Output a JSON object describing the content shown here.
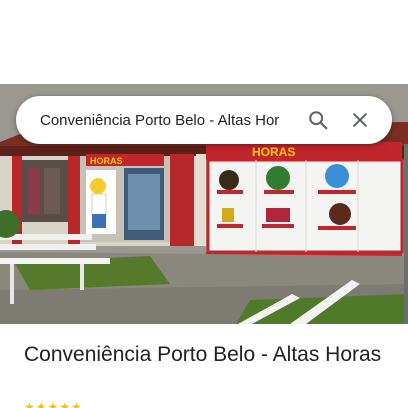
{
  "search": {
    "query": "Conveniência Porto Belo - Altas Hor",
    "search_icon": "search-icon",
    "close_icon": "close-icon"
  },
  "photo": {
    "sign_text": "HORAS",
    "sign_text_short": "HORAS"
  },
  "place": {
    "title": "Conveniência Porto Belo - Altas Horas",
    "rating_stars": "★★★★★"
  },
  "colors": {
    "facade_red": "#c0262c",
    "search_icon": "#5f6368",
    "title_text": "#202124",
    "star": "#fbbc04"
  }
}
